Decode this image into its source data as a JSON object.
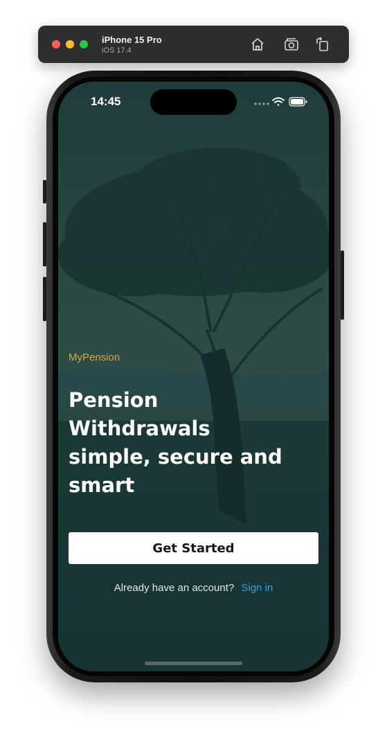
{
  "simulator": {
    "device_name": "iPhone 15 Pro",
    "os_version": "iOS 17.4",
    "buttons": [
      "home-icon",
      "screenshot-icon",
      "rotate-icon"
    ]
  },
  "status_bar": {
    "time": "14:45",
    "icons": [
      "cellular-signal-icon",
      "wifi-icon",
      "battery-icon"
    ]
  },
  "welcome": {
    "brand": "MyPension",
    "headline": "Pension Withdrawals simple, secure and smart",
    "cta_label": "Get Started",
    "signin_prompt": "Already have an account?",
    "signin_link": "Sign in"
  },
  "colors": {
    "overlay": "#16302f",
    "brand": "#d6a546",
    "link": "#2ea3e6",
    "button_bg": "#ffffff"
  }
}
